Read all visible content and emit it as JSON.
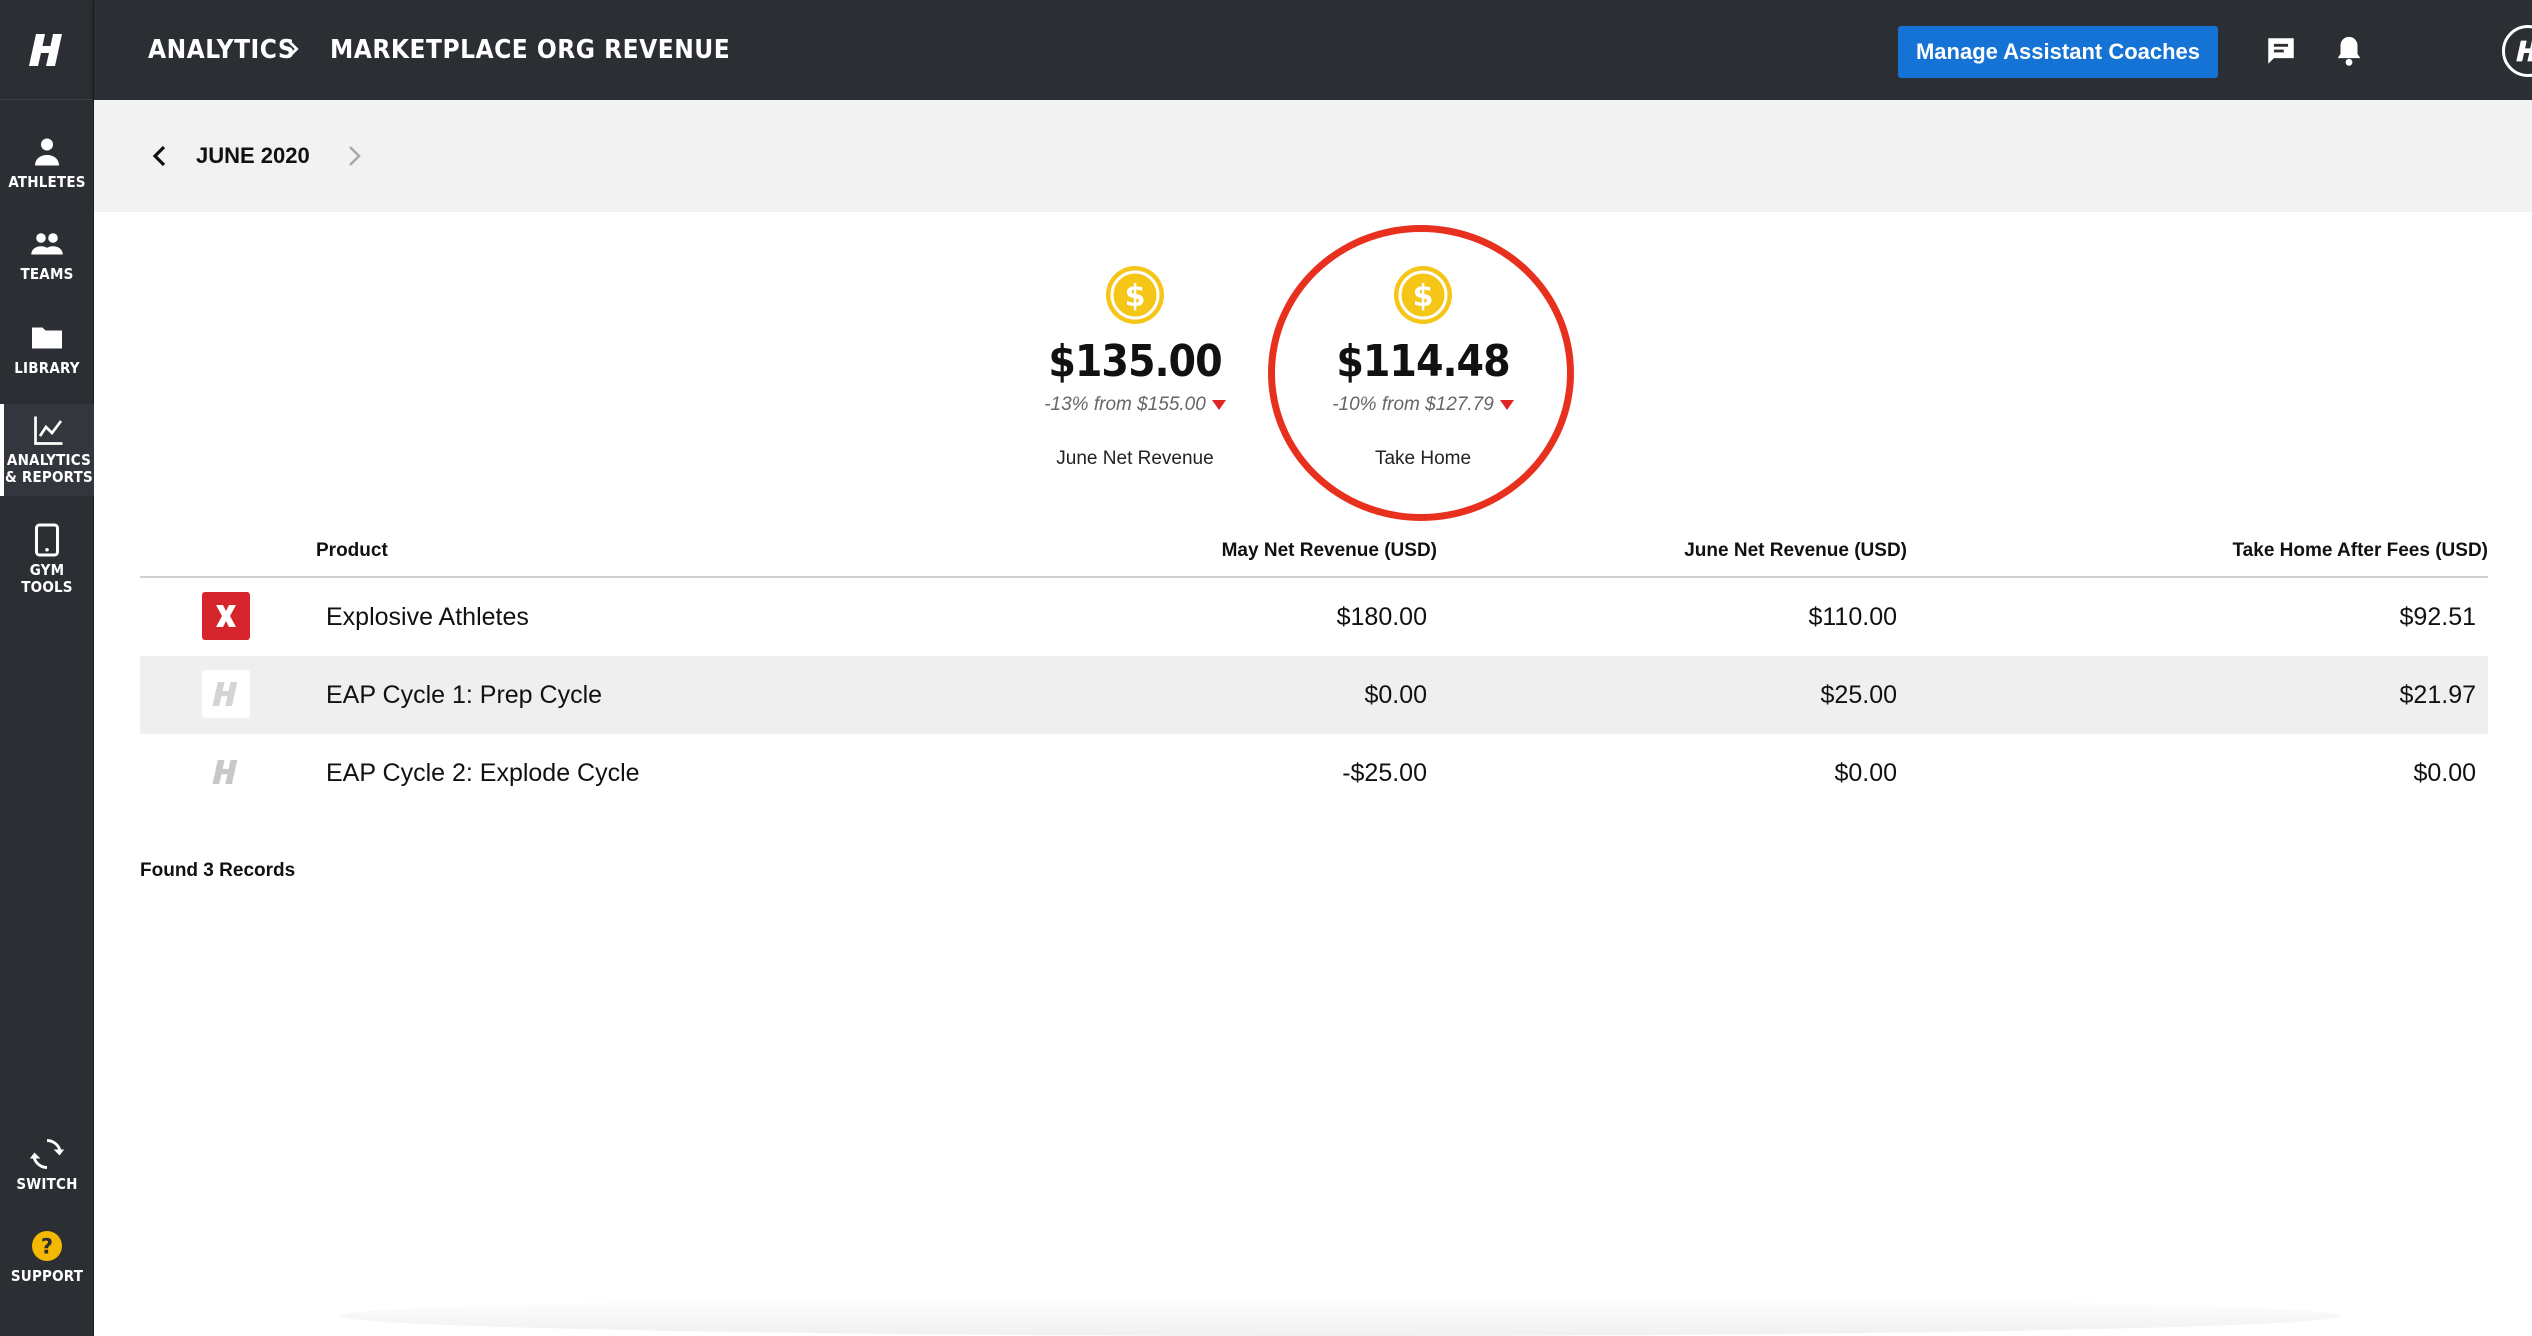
{
  "sidebar": {
    "logo": "H",
    "items": [
      {
        "label": "ATHLETES",
        "icon": "person-icon"
      },
      {
        "label": "TEAMS",
        "icon": "group-icon"
      },
      {
        "label": "LIBRARY",
        "icon": "folder-icon"
      },
      {
        "label": "ANALYTICS\n& REPORTS",
        "icon": "chart-line-icon",
        "active": true
      },
      {
        "label": "GYM\nTOOLS",
        "icon": "tablet-icon"
      }
    ],
    "bottom_items": [
      {
        "label": "SWITCH",
        "icon": "refresh-icon"
      },
      {
        "label": "SUPPORT",
        "icon": "help-icon"
      }
    ]
  },
  "header": {
    "breadcrumb": [
      "ANALYTICS",
      "MARKETPLACE ORG REVENUE"
    ],
    "manage_button": "Manage Assistant Coaches",
    "icons": [
      "chat-icon",
      "bell-icon",
      "avatar-icon",
      "chevron-down-icon"
    ]
  },
  "month_nav": {
    "label": "JUNE 2020"
  },
  "summary": {
    "net_revenue": {
      "amount": "$135.00",
      "change": "-13% from $155.00",
      "label": "June Net Revenue"
    },
    "take_home": {
      "amount": "$114.48",
      "change": "-10% from $127.79",
      "label": "Take Home"
    }
  },
  "table": {
    "columns": [
      "Product",
      "May Net Revenue (USD)",
      "June Net Revenue (USD)",
      "Take Home After Fees (USD)"
    ],
    "rows": [
      {
        "icon": "x-brand-icon",
        "product": "Explosive Athletes",
        "may": "$180.00",
        "june": "$110.00",
        "take_home": "$92.51"
      },
      {
        "icon": "h-logo-icon",
        "product": "EAP Cycle 1: Prep Cycle",
        "may": "$0.00",
        "june": "$25.00",
        "take_home": "$21.97"
      },
      {
        "icon": "h-logo-icon",
        "product": "EAP Cycle 2: Explode Cycle",
        "may": "-$25.00",
        "june": "$0.00",
        "take_home": "$0.00"
      }
    ],
    "records_text": "Found 3 Records"
  },
  "colors": {
    "sidebar_bg": "#2b2e33",
    "accent_blue": "#1573d6",
    "highlight_red": "#e8301f",
    "coin_gold": "#f5c518",
    "down_red": "#e02424"
  }
}
